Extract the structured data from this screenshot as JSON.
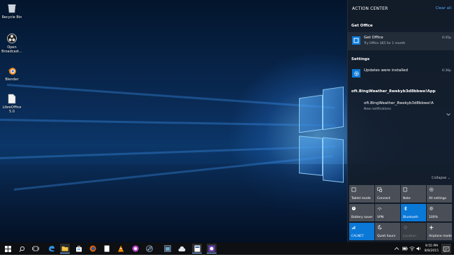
{
  "desktop_icons": [
    {
      "label": "Recycle Bin",
      "icon": "recycle-bin-icon"
    },
    {
      "label": "Open Broadcast...",
      "icon": "obs-icon"
    },
    {
      "label": "Blender",
      "icon": "blender-icon"
    },
    {
      "label": "LibreOffice 5.0",
      "icon": "libreoffice-icon"
    }
  ],
  "action_center": {
    "title": "ACTION CENTER",
    "clear_all": "Clear all",
    "groups": [
      {
        "name": "Get Office",
        "items": [
          {
            "title": "Get Office",
            "subtitle": "Try Office 365 for 1 month",
            "time": "6:45p",
            "icon": "office-icon"
          }
        ]
      },
      {
        "name": "Settings",
        "items": [
          {
            "title": "Updates were installed",
            "subtitle": "",
            "time": "6:36p",
            "icon": "gear-icon"
          }
        ]
      },
      {
        "name": "oft.BingWeather_8wekyb3d8bbwe!App",
        "items": [
          {
            "title": "oft.BingWeather_8wekyb3d8bbwe!A",
            "subtitle": "New notifications",
            "time": "",
            "icon": ""
          }
        ]
      }
    ],
    "collapse": "Collapse",
    "quick_actions": [
      {
        "label": "Tablet mode",
        "on": false,
        "icon": "tablet-icon"
      },
      {
        "label": "Connect",
        "on": false,
        "icon": "connect-icon"
      },
      {
        "label": "Note",
        "on": false,
        "icon": "note-icon"
      },
      {
        "label": "All settings",
        "on": false,
        "icon": "gear-icon"
      },
      {
        "label": "Battery saver",
        "on": false,
        "icon": "battery-icon"
      },
      {
        "label": "VPN",
        "on": false,
        "icon": "vpn-icon"
      },
      {
        "label": "Bluetooth",
        "on": true,
        "icon": "bluetooth-icon"
      },
      {
        "label": "100%",
        "on": false,
        "icon": "brightness-icon"
      },
      {
        "label": "CALNET",
        "on": true,
        "icon": "wifi-icon"
      },
      {
        "label": "Quiet hours",
        "on": false,
        "icon": "moon-icon"
      },
      {
        "label": "Location",
        "on": false,
        "icon": "location-icon"
      },
      {
        "label": "Airplane mode",
        "on": false,
        "icon": "airplane-icon"
      }
    ]
  },
  "taskbar": {
    "time": "9:55 PM",
    "date": "8/8/2015",
    "accent": "#0a78d7"
  }
}
